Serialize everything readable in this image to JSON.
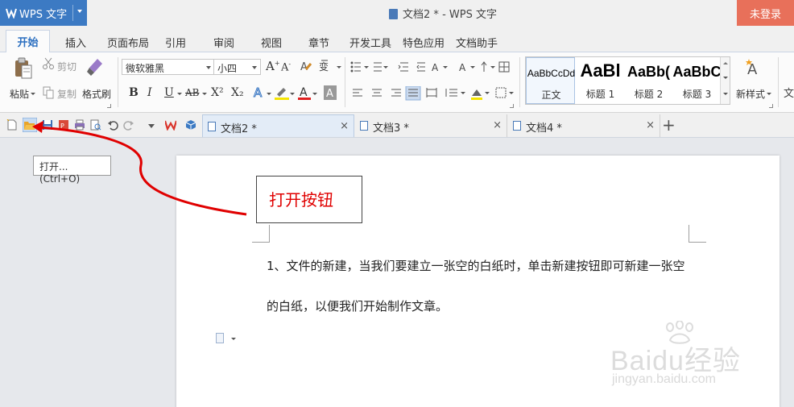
{
  "app": {
    "name": "WPS 文字",
    "window_title": "文档2 * - WPS 文字",
    "login_label": "未登录"
  },
  "menu_tabs": [
    "开始",
    "插入",
    "页面布局",
    "引用",
    "审阅",
    "视图",
    "章节",
    "开发工具",
    "特色应用",
    "文档助手"
  ],
  "clipboard": {
    "paste": "粘贴",
    "cut": "剪切",
    "copy": "复制",
    "format_painter": "格式刷"
  },
  "font": {
    "family": "微软雅黑",
    "size": "小四",
    "bold": "B",
    "italic": "I",
    "underline": "U",
    "strike": "AB",
    "superscript": "X²",
    "subscript": "X₂"
  },
  "styles": {
    "items": [
      {
        "sample": "AaBbCcDd",
        "name": "正文"
      },
      {
        "sample": "AaBl",
        "name": "标题 1"
      },
      {
        "sample": "AaBb(",
        "name": "标题 2"
      },
      {
        "sample": "AaBbC",
        "name": "标题 3"
      }
    ],
    "new_style": "新样式"
  },
  "doc_tabs": [
    {
      "name": "文档2 *",
      "close": "×"
    },
    {
      "name": "文档3 *",
      "close": "×"
    },
    {
      "name": "文档4 *",
      "close": "×"
    }
  ],
  "new_tab": "+",
  "tooltip": "打开... (Ctrl+O)",
  "callout": "打开按钮",
  "document": {
    "line1": "1、文件的新建，当我们要建立一张空的白纸时，单击新建按钮即可新建一张空",
    "line2": "的白纸，以便我们开始制作文章。"
  },
  "watermark": {
    "brand": "Baidu经验",
    "url": "jingyan.baidu.com"
  },
  "colors": {
    "app_blue": "#3c7ac3",
    "login_orange": "#e8705a",
    "annotation_red": "#e00000",
    "font_color_red": "#e02020",
    "highlight_yellow": "#f5e400"
  }
}
